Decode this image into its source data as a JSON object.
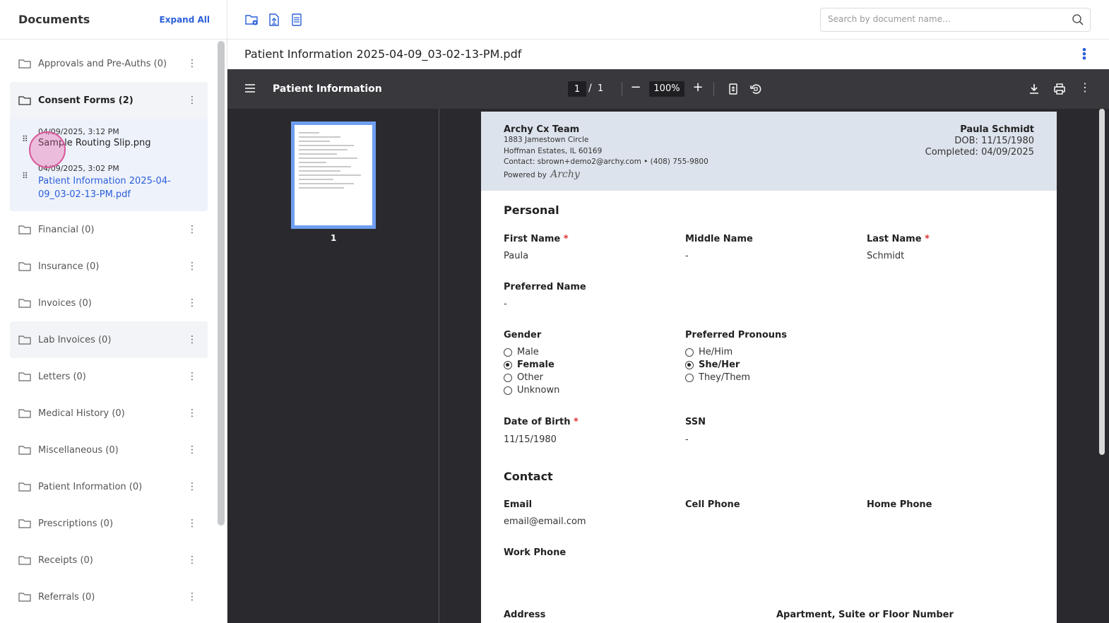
{
  "sidebar": {
    "title": "Documents",
    "expand_all": "Expand All",
    "folders_top": [
      {
        "label": "Approvals and Pre-Auths (0)"
      }
    ],
    "open_folder": {
      "label": "Consent Forms (2)",
      "files": [
        {
          "date": "04/09/2025, 3:12 PM",
          "name": "Sample Routing Slip.png"
        },
        {
          "date": "04/09/2025, 3:02 PM",
          "name": "Patient Information 2025-04-09_03-02-13-PM.pdf"
        }
      ]
    },
    "folders": [
      {
        "label": "Financial (0)"
      },
      {
        "label": "Insurance (0)"
      },
      {
        "label": "Invoices (0)"
      },
      {
        "label": "Lab Invoices (0)"
      },
      {
        "label": "Letters (0)"
      },
      {
        "label": "Medical History (0)"
      },
      {
        "label": "Miscellaneous (0)"
      },
      {
        "label": "Patient Information (0)"
      },
      {
        "label": "Prescriptions (0)"
      },
      {
        "label": "Receipts (0)"
      },
      {
        "label": "Referrals (0)"
      }
    ]
  },
  "search": {
    "placeholder": "Search by document name..."
  },
  "document": {
    "title": "Patient Information 2025-04-09_03-02-13-PM.pdf"
  },
  "viewer": {
    "title": "Patient Information",
    "page_current": "1",
    "page_sep": "/",
    "page_total": "1",
    "zoom": "100%",
    "thumb_label": "1"
  },
  "pdf": {
    "org": "Archy Cx Team",
    "address1": "1883 Jamestown Circle",
    "address2": "Hoffman Estates, IL 60169",
    "contact": "Contact: sbrown+demo2@archy.com • (408) 755-9800",
    "powered_by": "Powered by",
    "brand": "Archy",
    "patient_name": "Paula Schmidt",
    "dob": "DOB: 11/15/1980",
    "completed": "Completed: 04/09/2025",
    "personal_heading": "Personal",
    "first_name_label": "First Name",
    "first_name": "Paula",
    "middle_name_label": "Middle Name",
    "middle_name": "-",
    "last_name_label": "Last Name",
    "last_name": "Schmidt",
    "preferred_name_label": "Preferred Name",
    "preferred_name": "-",
    "gender_label": "Gender",
    "gender_options": [
      "Male",
      "Female",
      "Other",
      "Unknown"
    ],
    "pronouns_label": "Preferred Pronouns",
    "pronoun_options": [
      "He/Him",
      "She/Her",
      "They/Them"
    ],
    "dob_label": "Date of Birth",
    "dob_value": "11/15/1980",
    "ssn_label": "SSN",
    "ssn_value": "-",
    "contact_heading": "Contact",
    "email_label": "Email",
    "email_value": "email@email.com",
    "cell_label": "Cell Phone",
    "home_label": "Home Phone",
    "work_label": "Work Phone",
    "address_label": "Address",
    "apt_label": "Apartment, Suite or Floor Number",
    "required_mark": "*"
  }
}
